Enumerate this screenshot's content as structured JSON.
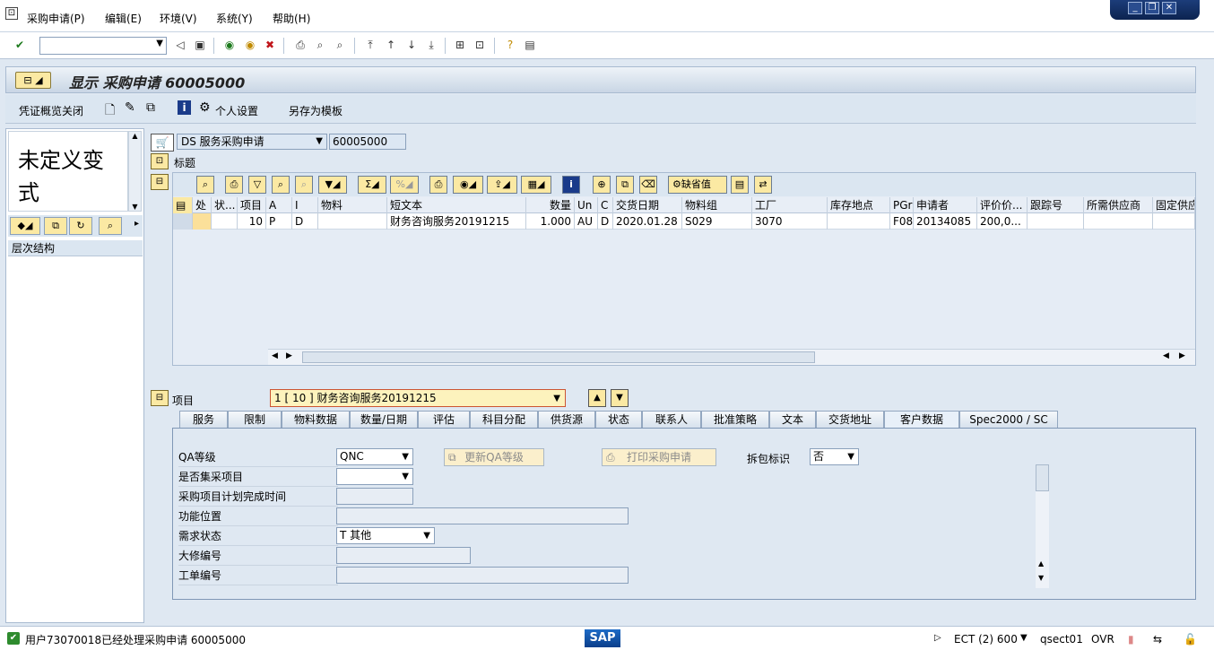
{
  "menu": {
    "items": [
      "采购申请(P)",
      "编辑(E)",
      "环境(V)",
      "系统(Y)",
      "帮助(H)"
    ]
  },
  "window_controls": [
    "_",
    "❐",
    "✕"
  ],
  "title": "显示 采购申请 60005000",
  "app_toolbar": {
    "overview_close": "凭证概览关闭",
    "personal_settings": "个人设置",
    "save_as_template": "另存为模板"
  },
  "left": {
    "variant": "未定义变式",
    "hierarchy_header": "层次结构"
  },
  "header": {
    "doc_type": "DS 服务采购申请",
    "doc_number": "60005000",
    "header_label": "标题"
  },
  "grid": {
    "toolbar_default_values": "缺省值",
    "columns": [
      "处",
      "状...",
      "项目",
      "A",
      "I",
      "物料",
      "短文本",
      "数量",
      "Un",
      "C",
      "交货日期",
      "物料组",
      "工厂",
      "库存地点",
      "PGr",
      "申请者",
      "评价价...",
      "跟踪号",
      "所需供应商",
      "固定供应"
    ],
    "rows": [
      [
        "",
        "",
        "10",
        "P",
        "D",
        "",
        "财务咨询服务20191215",
        "1.000",
        "AU",
        "D",
        "2020.01.28",
        "S029",
        "3070",
        "",
        "F08",
        "20134085",
        "200,0...",
        "",
        "",
        ""
      ]
    ]
  },
  "item": {
    "label": "项目",
    "selected": "1 [ 10 ] 财务咨询服务20191215"
  },
  "tabs": [
    "服务",
    "限制",
    "物料数据",
    "数量/日期",
    "评估",
    "科目分配",
    "供货源",
    "状态",
    "联系人",
    "批准策略",
    "文本",
    "交货地址",
    "客户数据",
    "Spec2000 / SC"
  ],
  "active_tab": "客户数据",
  "customer_data": {
    "qa_level_label": "QA等级",
    "qa_level_value": "QNC",
    "update_qa_button": "更新QA等级",
    "print_pr_button": "打印采购申请",
    "unpack_label": "拆包标识",
    "unpack_value": "否",
    "centralized_label": "是否集采项目",
    "centralized_value": "",
    "plan_complete_label": "采购项目计划完成时间",
    "plan_complete_value": "",
    "function_loc_label": "功能位置",
    "function_loc_value": "",
    "demand_status_label": "需求状态",
    "demand_status_value": "T 其他",
    "overhaul_label": "大修编号",
    "overhaul_value": "",
    "work_order_label": "工单编号",
    "work_order_value": ""
  },
  "status": {
    "message": "用户73070018已经处理采购申请 60005000",
    "logo": "SAP",
    "system": "ECT (2) 600",
    "server": "qsect01",
    "mode": "OVR"
  },
  "colors": {
    "accent_yellow": "#fbe9a3",
    "frame_blue": "#7f97b6",
    "background": "#dfe8f2"
  }
}
